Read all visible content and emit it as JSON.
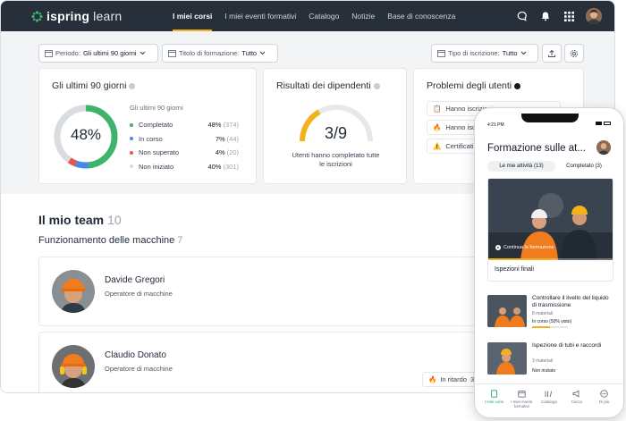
{
  "brand": {
    "logo_text": "ispring",
    "logo_text2": "learn"
  },
  "nav": {
    "items": [
      {
        "label": "I miei corsi",
        "active": true
      },
      {
        "label": "I miei eventi formativi",
        "active": false
      },
      {
        "label": "Catalogo",
        "active": false
      },
      {
        "label": "Notizie",
        "active": false
      },
      {
        "label": "Base di conoscenza",
        "active": false
      }
    ]
  },
  "filters": {
    "period_label": "Periodo:",
    "period_value": "Gli ultimi 90 giorni",
    "title_label": "Titolo di formazione:",
    "title_value": "Tutto",
    "enroll_label": "Tipo di iscrizione:",
    "enroll_value": "Tutto"
  },
  "card_progress": {
    "title": "Gli ultimi 90 giorni",
    "percent": "48%",
    "legend_head": "Gli ultimi 90 giorni",
    "rows": [
      {
        "name": "Completato",
        "pct": "48%",
        "count": "(374)",
        "color": "#3db36b",
        "share": 0.48
      },
      {
        "name": "In corso",
        "pct": "7%",
        "count": "(44)",
        "color": "#4a86e8",
        "share": 0.07
      },
      {
        "name": "Non superato",
        "pct": "4%",
        "count": "(20)",
        "color": "#e4574d",
        "share": 0.04
      },
      {
        "name": "Non iniziato",
        "pct": "40%",
        "count": "(301)",
        "color": "#d9dce1",
        "share": 0.4
      }
    ]
  },
  "card_results": {
    "title": "Risultati dei dipendenti",
    "value": "3/9",
    "ratio": 0.3333,
    "caption_line1": "Utenti hanno completato tutte",
    "caption_line2": "le iscrizioni"
  },
  "card_problems": {
    "title": "Problemi degli utenti",
    "items": [
      {
        "icon": "📋",
        "text": "Hanno iscrizioni"
      },
      {
        "icon": "🔥",
        "text": "Hanno iscrizioni"
      },
      {
        "icon": "⚠️",
        "text": "Certificati"
      }
    ]
  },
  "team": {
    "title": "Il mio team",
    "count": "10",
    "group_name": "Funzionamento delle macchine",
    "group_count": "7",
    "people": [
      {
        "name": "Davide Gregori",
        "role": "Operatore di macchine"
      },
      {
        "name": "Claudio Donato",
        "role": "Operatore di macchine"
      }
    ],
    "late_badge": "In ritardo",
    "late_count": "3"
  },
  "phone": {
    "time": "4:21 PM",
    "title": "Formazione sulle at...",
    "tabs": [
      {
        "label": "Le mie attività (13)",
        "active": true
      },
      {
        "label": "Completato (3)",
        "active": false
      }
    ],
    "feature_cta": "Continua la formazione",
    "feature_title": "Ispezioni finali",
    "courses": [
      {
        "title": "Controllare il livello del liquido di trasmissione",
        "meta": "8 materiali",
        "status": "In corso (50% visto)",
        "progress": 0.5
      },
      {
        "title": "Ispezione di tubi e raccordi",
        "meta": "3 materiali",
        "status": "Non iniziato",
        "progress": 0
      }
    ],
    "bottom_nav": [
      {
        "label": "I miei corsi",
        "active": true
      },
      {
        "label": "I miei eventi formativi",
        "active": false
      },
      {
        "label": "Catalogo",
        "active": false
      },
      {
        "label": "Cerca",
        "active": false
      },
      {
        "label": "Di più",
        "active": false
      }
    ]
  }
}
